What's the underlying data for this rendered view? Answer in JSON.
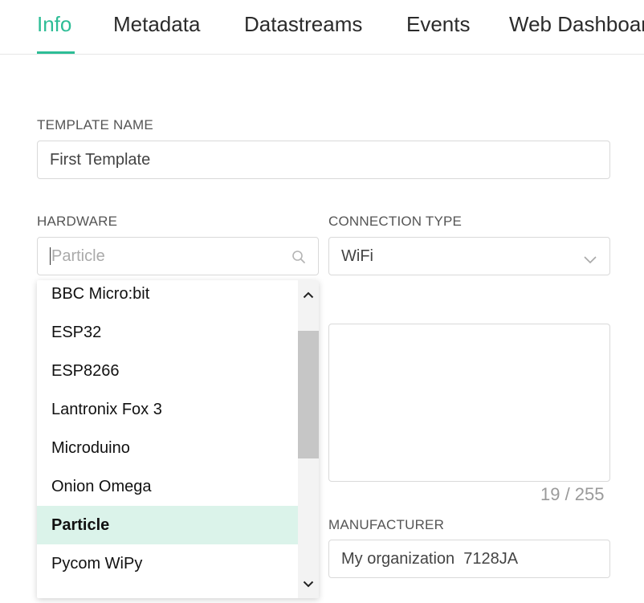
{
  "tabs": [
    {
      "label": "Info",
      "active": true
    },
    {
      "label": "Metadata"
    },
    {
      "label": "Datastreams"
    },
    {
      "label": "Events"
    },
    {
      "label": "Web Dashboard"
    }
  ],
  "template_name": {
    "label": "TEMPLATE NAME",
    "value": "First Template"
  },
  "hardware": {
    "label": "HARDWARE",
    "placeholder": "Particle",
    "options": [
      "BBC Micro:bit",
      "ESP32",
      "ESP8266",
      "Lantronix Fox 3",
      "Microduino",
      "Onion Omega",
      "Particle",
      "Pycom WiPy"
    ],
    "selected": "Particle"
  },
  "connection_type": {
    "label": "CONNECTION TYPE",
    "value": "WiFi"
  },
  "description": {
    "counter": "19 / 255"
  },
  "manufacturer": {
    "label": "MANUFACTURER",
    "value": "My organization  7128JA"
  },
  "colors": {
    "accent": "#2dbd96",
    "selected_bg": "#dbf3ea"
  }
}
